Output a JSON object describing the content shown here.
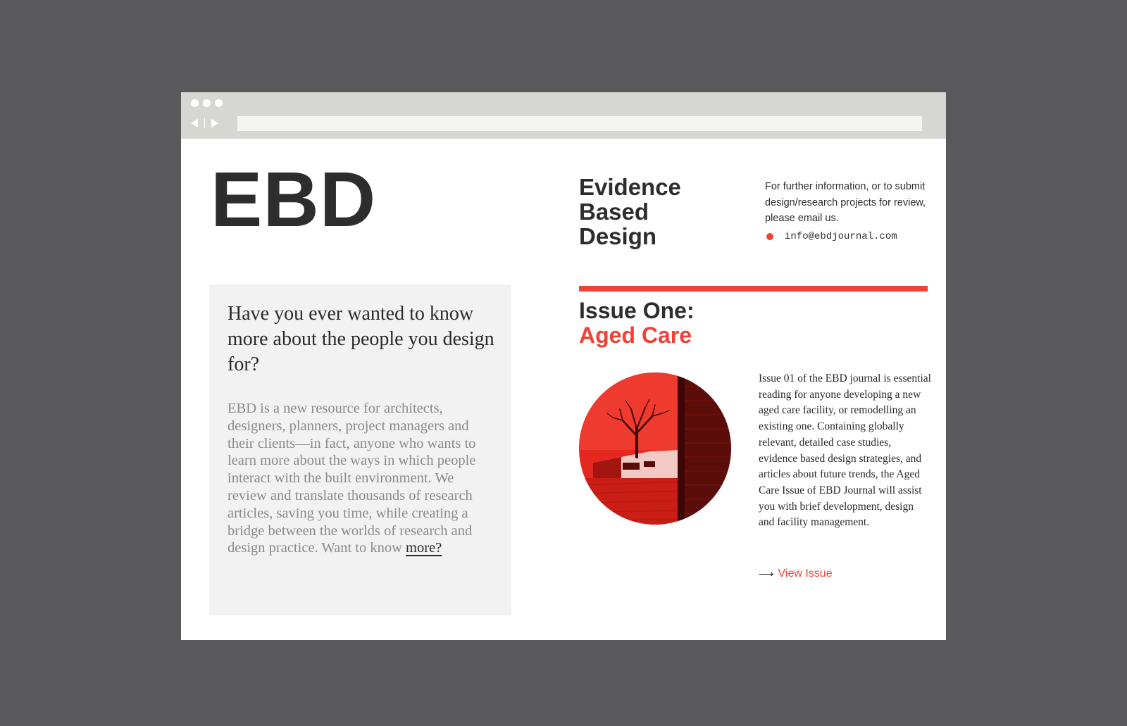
{
  "browser": {
    "window_dots": [
      "close",
      "minimize",
      "maximize"
    ],
    "nav_back_icon": "chevron-left-icon",
    "nav_forward_icon": "chevron-right-icon",
    "url": ""
  },
  "logo": {
    "text": "EBD"
  },
  "intro": {
    "heading": "Have you ever wanted to know more about the people you design for?",
    "body": "EBD is a new resource for architects, designers, planners, project managers and their clients—in fact, anyone who wants to learn more about the ways in which people interact with the built environment. We review and translate thousands of research articles, saving you time, while creating a bridge between the worlds of research and design practice. Want to know ",
    "more_label": "more?"
  },
  "title": {
    "line1": "Evidence",
    "line2": "Based",
    "line3": "Design"
  },
  "contact": {
    "text": "For further information, or to submit design/research projects for review, please email us.",
    "email": "info@ebdjournal.com"
  },
  "issue": {
    "title": "Issue One:",
    "subtitle": "Aged Care",
    "description": "Issue 01 of the EBD journal is essential reading for anyone developing a new aged care facility, or remodelling an existing one. Containing globally relevant, detailed case studies, evidence based design strategies, and articles about future trends, the Aged Care Issue of EBD Journal will assist you with brief development, design and facility management.",
    "view_label": "View Issue",
    "arrow_icon": "arrow-right-icon"
  },
  "colors": {
    "accent": "#ef4136",
    "text": "#2d2d2d",
    "muted": "#8a8a8a",
    "backdrop": "#59595b",
    "chrome": "#d6d6d3"
  }
}
